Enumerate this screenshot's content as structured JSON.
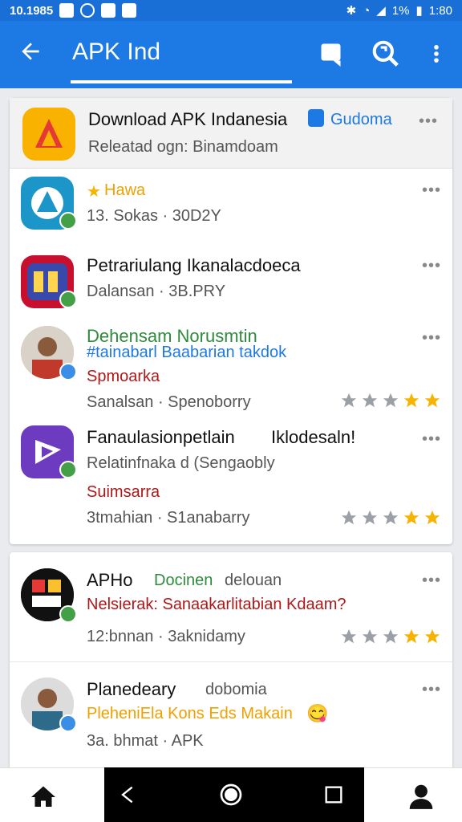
{
  "status": {
    "time": "10.1985",
    "battery": "1%",
    "clock": "1:80"
  },
  "appbar": {
    "title": "APK Ind"
  },
  "header": {
    "title": "Download APK Indanesia",
    "title_extra": "Gudoma",
    "subtitle": "Releatad ogn: Binamdoam",
    "more": "•••"
  },
  "items": [
    {
      "line1": "Hawa",
      "line2": "13. Sokas · 30D2Y",
      "more": "•••"
    },
    {
      "line1": "Petrariulang Ikanalacdoeca",
      "line2": "Dalansan · 3B.PRY",
      "more": "•••"
    },
    {
      "line1": "Dehensam Norusmtin",
      "line1b": "#tainabarl Baabarian takdok",
      "line2": "Spmoarka",
      "line3": "Sanalsan · Spenoborry",
      "stars": 5,
      "more": "•••"
    },
    {
      "line1": "Fanaulasionpetlain",
      "line1b": "Iklodesaln!",
      "line2": "Relatinfnaka d (Sengaobly",
      "line3": "Suimsarra",
      "line4": "3tmahian · S1anabarry",
      "stars": 5,
      "more": "•••"
    }
  ],
  "items2": [
    {
      "line1": "APHo",
      "line1b": "Docinen",
      "line1c": "delouan",
      "line2": "Nelsierak: Sanaakarlitabian Kdaam?",
      "line3": "12:bnnan · 3aknidamy",
      "stars": 5,
      "more": "•••"
    },
    {
      "line1": "Planedeary",
      "line1b": "dobomia",
      "line2": "PleheniEla Kons Eds Makain",
      "line3": "3a. bhmat · APK",
      "more": "•••"
    }
  ],
  "colors": {
    "primary": "#1d7ae4",
    "status": "#1a6fd6",
    "star": "#f6b400",
    "star_gray": "#9aa0a6"
  }
}
